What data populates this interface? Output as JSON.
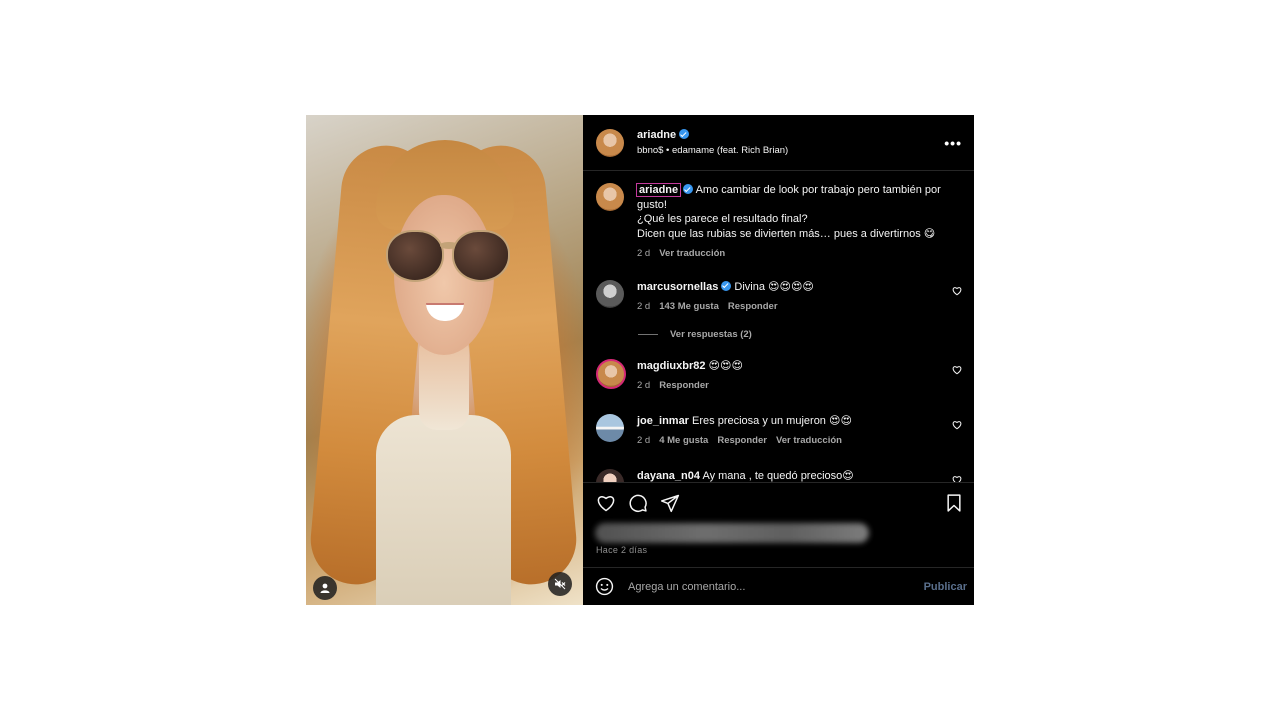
{
  "header": {
    "username": "ariadne",
    "audio": "bbno$ • edamame (feat. Rich Brian)"
  },
  "caption": {
    "username": "ariadne",
    "text_line1": "Amo cambiar de look por trabajo pero también por gusto!",
    "text_line2": "¿Qué les parece el resultado final?",
    "text_line3": "Dicen que las rubias se divierten más… pues a divertirnos 😋",
    "time": "2 d",
    "translate": "Ver traducción"
  },
  "comments": [
    {
      "username": "marcusornellas",
      "text": "Divina 😍😍😍😍",
      "time": "2 d",
      "likes": "143 Me gusta",
      "reply": "Responder",
      "view_replies": "Ver respuestas (2)"
    },
    {
      "username": "magdiuxbr82",
      "text": "😍😍😍",
      "time": "2 d",
      "reply": "Responder"
    },
    {
      "username": "joe_inmar",
      "text": "Eres preciosa y un mujeron 😍😍",
      "time": "2 d",
      "likes": "4 Me gusta",
      "reply": "Responder",
      "translate": "Ver traducción"
    },
    {
      "username": "dayana_n04",
      "text": "Ay mana , te quedó precioso😍"
    }
  ],
  "post_date": "Hace 2 días",
  "add_comment": {
    "placeholder": "Agrega un comentario...",
    "publish": "Publicar"
  },
  "colors": {
    "background": "#000000",
    "verified": "#3897f0",
    "publish": "#5a6f8c"
  }
}
